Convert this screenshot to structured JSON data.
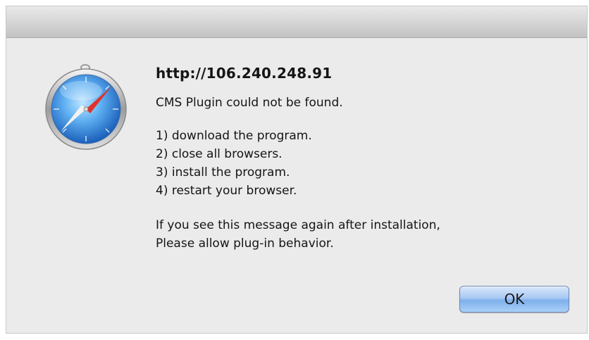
{
  "dialog": {
    "title": "http://106.240.248.91",
    "message": "CMS Plugin could not be found.",
    "steps": [
      "1) download the program.",
      "2) close all browsers.",
      "3) install the program.",
      "4) restart your browser."
    ],
    "note": [
      "If you see this message again after installation,",
      "Please allow plug-in behavior."
    ],
    "ok_label": "OK",
    "icon": "safari-compass-icon"
  },
  "colors": {
    "dialog_background": "#ebebeb",
    "button_blue": "#7fb0ec",
    "icon_blue": "#2f7fd8"
  }
}
